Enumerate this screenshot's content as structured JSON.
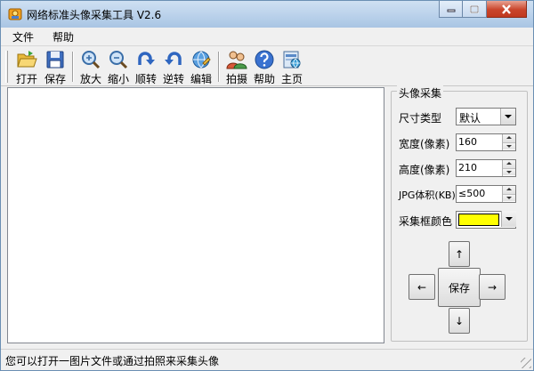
{
  "window": {
    "title": "网络标准头像采集工具 V2.6"
  },
  "menu": [
    "文件",
    "帮助"
  ],
  "toolbar": {
    "open": "打开",
    "save": "保存",
    "zoom_in": "放大",
    "zoom_out": "缩小",
    "rotate_cw": "顺转",
    "rotate_ccw": "逆转",
    "edit": "编辑",
    "capture": "拍摄",
    "help": "帮助",
    "home": "主页"
  },
  "panel": {
    "title": "头像采集",
    "size_type_label": "尺寸类型",
    "size_type_value": "默认",
    "width_label": "宽度(像素)",
    "width_value": "160",
    "height_label": "高度(像素)",
    "height_value": "210",
    "jpg_label": "JPG体积(KB)",
    "jpg_value": "≤500",
    "frame_color_label": "采集框颜色",
    "frame_color": "#ffff00",
    "save_button": "保存",
    "up_arrow": "↑",
    "down_arrow": "↓",
    "left_arrow": "←",
    "right_arrow": "→"
  },
  "status": {
    "text": "您可以打开一图片文件或通过拍照来采集头像"
  },
  "icons": {
    "app": "app-icon",
    "open": "folder-open-icon",
    "save": "floppy-disk-icon",
    "zoom_in": "magnifier-plus-icon",
    "zoom_out": "magnifier-minus-icon",
    "rotate_cw": "rotate-cw-icon",
    "rotate_ccw": "rotate-ccw-icon",
    "edit": "globe-edit-icon",
    "capture": "people-camera-icon",
    "help": "question-icon",
    "home": "home-page-icon"
  }
}
